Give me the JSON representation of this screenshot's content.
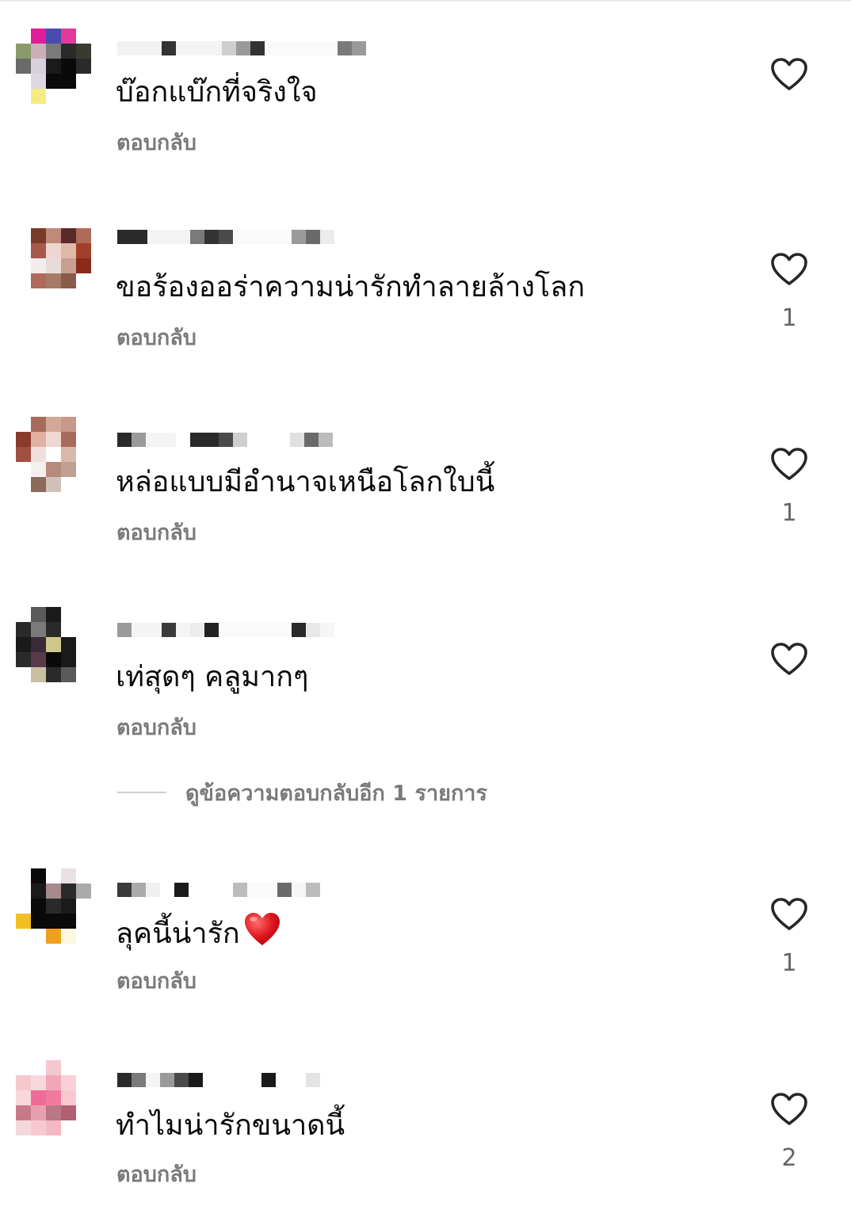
{
  "comments": [
    {
      "text": "บ๊อกแบ๊กที่จริงใจ",
      "reply_label": "ตอบกลับ",
      "like_count": "",
      "like_icon": "heart-outline-icon"
    },
    {
      "text": "ขอร้องออร่าความน่ารักทำลายล้างโลก",
      "reply_label": "ตอบกลับ",
      "like_count": "1",
      "like_icon": "heart-outline-icon"
    },
    {
      "text": "หล่อแบบมีอำนาจเหนือโลกใบนี้",
      "reply_label": "ตอบกลับ",
      "like_count": "1",
      "like_icon": "heart-outline-icon"
    },
    {
      "text": "เท่สุดๆ คลูมากๆ",
      "reply_label": "ตอบกลับ",
      "like_count": "",
      "like_icon": "heart-outline-icon"
    },
    {
      "text": "ลุคนี้น่ารัก",
      "emoji": "❤️",
      "reply_label": "ตอบกลับ",
      "like_count": "1",
      "like_icon": "heart-outline-icon"
    },
    {
      "text": "ทำไมน่ารักขนาดนี้",
      "reply_label": "ตอบกลับ",
      "like_count": "2",
      "like_icon": "heart-outline-icon"
    }
  ],
  "view_replies": {
    "label": "ดูข้อความตอบกลับอีก 1 รายการ"
  },
  "colors": {
    "text": "#0a0a0a",
    "secondary": "#7a7a7a",
    "like_outline": "#262626",
    "background": "#ffffff"
  }
}
